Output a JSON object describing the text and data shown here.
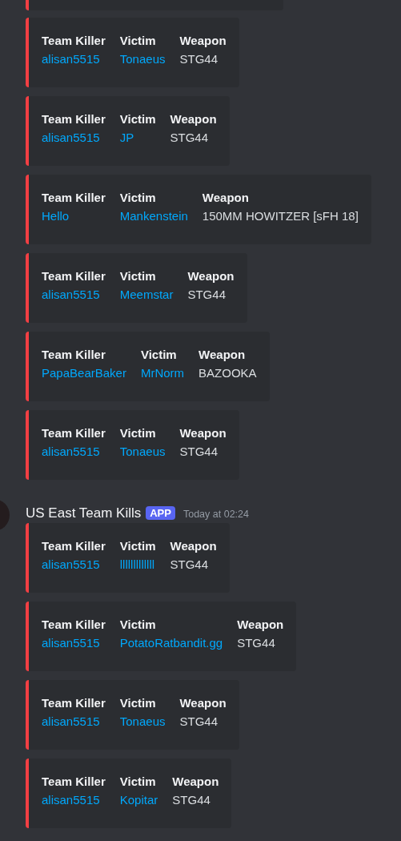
{
  "messages": [
    {
      "embeds": [
        {
          "fields": [
            {
              "name": "Team Killer",
              "value": "alisan5515"
            },
            {
              "name": "Victim",
              "value": "Tonaeus"
            },
            {
              "name": "Weapon",
              "value": "STG44",
              "kind": "plain"
            }
          ]
        },
        {
          "fields": [
            {
              "name": "Team Killer",
              "value": "alisan5515"
            },
            {
              "name": "Victim",
              "value": "JP"
            },
            {
              "name": "Weapon",
              "value": "STG44",
              "kind": "plain"
            }
          ]
        },
        {
          "fields": [
            {
              "name": "Team Killer",
              "value": "Hello"
            },
            {
              "name": "Victim",
              "value": "Mankenstein"
            },
            {
              "name": "Weapon",
              "value": "150MM HOWITZER [sFH 18]",
              "kind": "plain"
            }
          ]
        },
        {
          "fields": [
            {
              "name": "Team Killer",
              "value": "alisan5515"
            },
            {
              "name": "Victim",
              "value": "Meemstar"
            },
            {
              "name": "Weapon",
              "value": "STG44",
              "kind": "plain"
            }
          ]
        },
        {
          "fields": [
            {
              "name": "Team Killer",
              "value": "PapaBearBaker"
            },
            {
              "name": "Victim",
              "value": "MrNorm"
            },
            {
              "name": "Weapon",
              "value": "BAZOOKA",
              "kind": "plain"
            }
          ]
        },
        {
          "fields": [
            {
              "name": "Team Killer",
              "value": "alisan5515"
            },
            {
              "name": "Victim",
              "value": "Tonaeus"
            },
            {
              "name": "Weapon",
              "value": "STG44",
              "kind": "plain"
            }
          ]
        }
      ]
    },
    {
      "author": "US East Team Kills",
      "badge": "APP",
      "time": "Today at 02:24",
      "embeds": [
        {
          "fields": [
            {
              "name": "Team Killer",
              "value": "alisan5515"
            },
            {
              "name": "Victim",
              "value": "lllllllllllll"
            },
            {
              "name": "Weapon",
              "value": "STG44",
              "kind": "plain"
            }
          ]
        },
        {
          "fields": [
            {
              "name": "Team Killer",
              "value": "alisan5515"
            },
            {
              "name": "Victim",
              "value": "PotatoRatbandit.gg"
            },
            {
              "name": "Weapon",
              "value": "STG44",
              "kind": "plain"
            }
          ]
        },
        {
          "fields": [
            {
              "name": "Team Killer",
              "value": "alisan5515"
            },
            {
              "name": "Victim",
              "value": "Tonaeus"
            },
            {
              "name": "Weapon",
              "value": "STG44",
              "kind": "plain"
            }
          ]
        },
        {
          "fields": [
            {
              "name": "Team Killer",
              "value": "alisan5515"
            },
            {
              "name": "Victim",
              "value": "Kopitar"
            },
            {
              "name": "Weapon",
              "value": "STG44",
              "kind": "plain"
            }
          ]
        }
      ]
    }
  ]
}
